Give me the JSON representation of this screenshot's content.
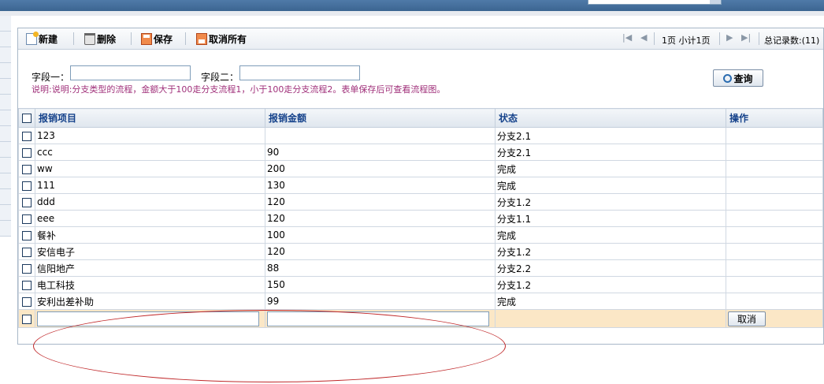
{
  "toolbar": {
    "new_label": "新建",
    "delete_label": "删除",
    "save_label": "保存",
    "cancel_all_label": "取消所有"
  },
  "pager": {
    "page_info": "1页 小计1页",
    "total": "总记录数:(11)"
  },
  "search": {
    "field1_label": "字段一：",
    "field2_label": "字段二：",
    "note": "说明:说明:分支类型的流程，金额大于100走分支流程1，小于100走分支流程2。表单保存后可查看流程图。",
    "query_label": "查询"
  },
  "grid": {
    "columns": [
      "报销项目",
      "报销金额",
      "状态",
      "操作"
    ],
    "rows": [
      {
        "item": "123",
        "amount": "",
        "status": "分支2.1"
      },
      {
        "item": "ccc",
        "amount": "90",
        "status": "分支2.1"
      },
      {
        "item": "ww",
        "amount": "200",
        "status": "完成"
      },
      {
        "item": "111",
        "amount": "130",
        "status": "完成"
      },
      {
        "item": "ddd",
        "amount": "120",
        "status": "分支1.2"
      },
      {
        "item": "eee",
        "amount": "120",
        "status": "分支1.1"
      },
      {
        "item": "餐补",
        "amount": "100",
        "status": "完成"
      },
      {
        "item": "安信电子",
        "amount": "120",
        "status": "分支1.2"
      },
      {
        "item": "信阳地产",
        "amount": "88",
        "status": "分支2.2"
      },
      {
        "item": "电工科技",
        "amount": "150",
        "status": "分支1.2"
      },
      {
        "item": "安利出差补助",
        "amount": "99",
        "status": "完成"
      }
    ],
    "edit_row": {
      "cancel_label": "取消"
    }
  }
}
